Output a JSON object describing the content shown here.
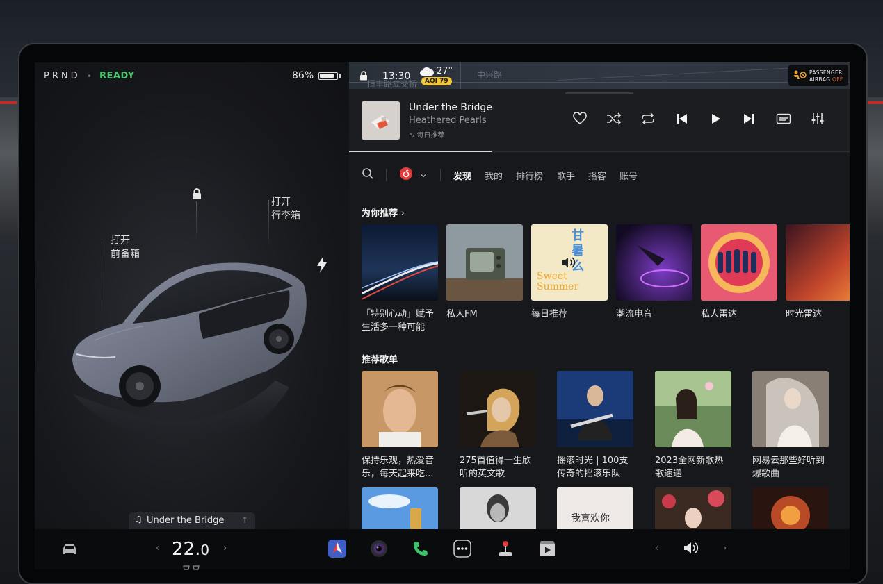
{
  "car": {
    "gears": "PRND",
    "separator": "•",
    "status": "READY",
    "battery_text": "86%",
    "battery_level": 0.86,
    "frunk_line1": "打开",
    "frunk_line2": "前备箱",
    "trunk_line1": "打开",
    "trunk_line2": "行李箱",
    "mini_player_title": "Under the Bridge",
    "mini_note_icon": "music-note-icon",
    "mini_up_icon": "chevron-up-icon"
  },
  "status_bar": {
    "time": "13:30",
    "temperature": "27°",
    "aqi": "AQI 79",
    "map_label_1": "恒丰路立交桥",
    "map_label_2": "中兴路",
    "airbag_line1": "PASSENGER",
    "airbag_line2_prefix": "AIRBAG ",
    "airbag_line2_state": "OFF",
    "airbag_state_color": "#e85a2a"
  },
  "now_playing": {
    "title": "Under the Bridge",
    "artist": "Heathered Pearls",
    "source": "每日推荐",
    "progress": 0.285
  },
  "nav": {
    "tabs": [
      "发现",
      "我的",
      "排行榜",
      "歌手",
      "播客",
      "账号"
    ],
    "active_tab": "发现"
  },
  "sections": {
    "recommend_title": "为你推荐",
    "playlists_title": "推荐歌单"
  },
  "recommend": [
    {
      "line1": "「特别心动」赋予",
      "line2": "生活多一种可能"
    },
    {
      "line1": "私人FM",
      "line2": ""
    },
    {
      "line1": "每日推荐",
      "line2": ""
    },
    {
      "line1": "潮流电音",
      "line2": ""
    },
    {
      "line1": "私人雷达",
      "line2": ""
    },
    {
      "line1": "时光雷达",
      "line2": ""
    }
  ],
  "playlists": [
    {
      "line1": "保持乐观，热爱音",
      "line2": "乐，每天起来吃..."
    },
    {
      "line1": "275首值得一生欣",
      "line2": "听的英文歌"
    },
    {
      "line1": "摇滚时光 | 100支",
      "line2": "传奇的摇滚乐队"
    },
    {
      "line1": "2023全网新歌热",
      "line2": "歌速递"
    },
    {
      "line1": "网易云那些好听到",
      "line2": "爆歌曲"
    }
  ],
  "tile_texts": {
    "daily_line1": "甘",
    "daily_line2": "暑",
    "daily_line3": "么",
    "daily_word1": "Sweet",
    "daily_word2": "Summer",
    "note_text": "我喜欢你"
  },
  "dock": {
    "cabin_temp": "22.",
    "cabin_temp_decimal": "0"
  },
  "colors": {
    "accent_red": "#e03a3a",
    "ready_green": "#4cc46b",
    "aqi_yellow": "#f2c53d"
  }
}
